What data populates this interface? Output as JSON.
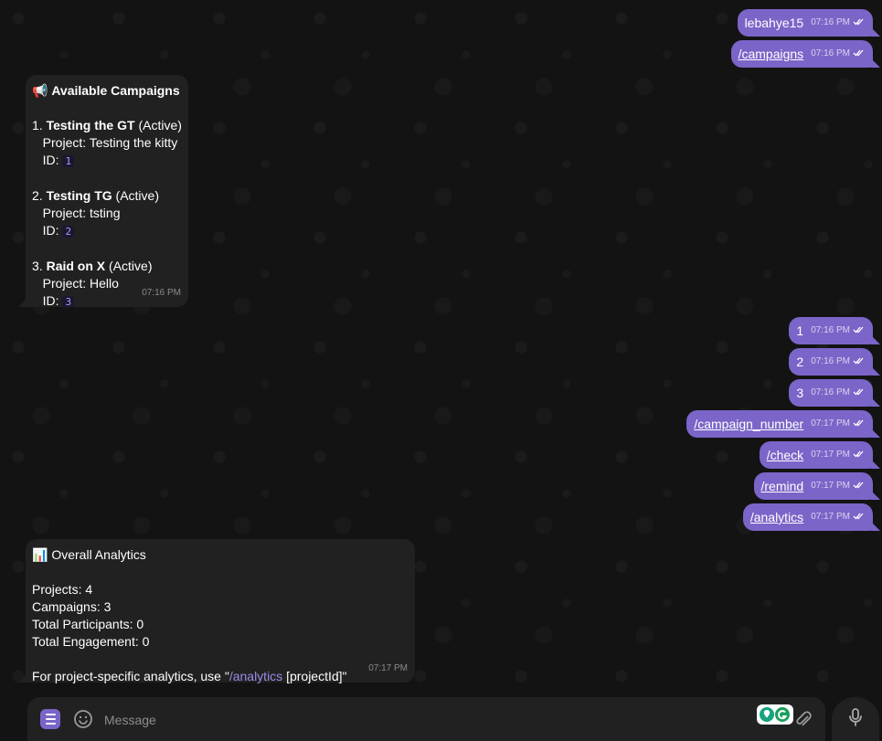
{
  "outgoing": [
    {
      "text": "lebahye15",
      "time": "07:16 PM",
      "is_command": false
    },
    {
      "text": "/campaigns",
      "time": "07:16 PM",
      "is_command": true
    },
    {
      "text": "1",
      "time": "07:16 PM",
      "is_command": false
    },
    {
      "text": "2",
      "time": "07:16 PM",
      "is_command": false
    },
    {
      "text": "3",
      "time": "07:16 PM",
      "is_command": false
    },
    {
      "text": "/campaign_number",
      "time": "07:17 PM",
      "is_command": true
    },
    {
      "text": "/check",
      "time": "07:17 PM",
      "is_command": true
    },
    {
      "text": "/remind",
      "time": "07:17 PM",
      "is_command": true
    },
    {
      "text": "/analytics",
      "time": "07:17 PM",
      "is_command": true
    }
  ],
  "campaigns_message": {
    "emoji": "📢",
    "title": "Available Campaigns",
    "items": [
      {
        "num": "1.",
        "name": "Testing the GT",
        "status": "(Active)",
        "project_label": "Project:",
        "project": "Testing the kitty",
        "id_label": "ID:",
        "id": "1"
      },
      {
        "num": "2.",
        "name": "Testing TG",
        "status": "(Active)",
        "project_label": "Project:",
        "project": "tsting",
        "id_label": "ID:",
        "id": "2"
      },
      {
        "num": "3.",
        "name": "Raid on X",
        "status": "(Active)",
        "project_label": "Project:",
        "project": "Hello",
        "id_label": "ID:",
        "id": "3"
      }
    ],
    "time": "07:16 PM"
  },
  "analytics_message": {
    "emoji": "📊",
    "title": "Overall Analytics",
    "lines": [
      "Projects: 4",
      "Campaigns: 3",
      "Total Participants: 0",
      "Total Engagement: 0"
    ],
    "footer_prefix": "For project-specific analytics, use \"",
    "footer_link": "/analytics",
    "footer_suffix": " [projectId]\"",
    "time": "07:17 PM"
  },
  "composer": {
    "placeholder": "Message"
  },
  "colors": {
    "outgoing_bubble": "#7b65c8",
    "incoming_bubble": "#212121",
    "background": "#131313",
    "link": "#9d8bea"
  }
}
